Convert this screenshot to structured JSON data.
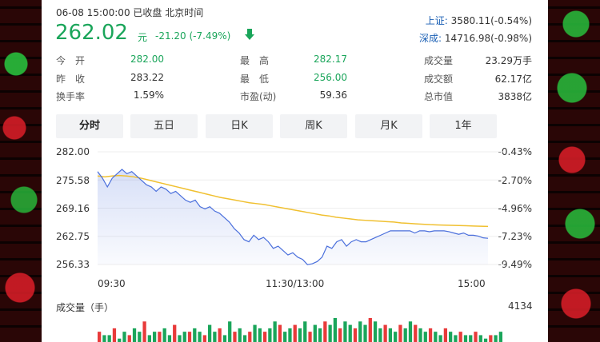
{
  "header": {
    "timestamp": "06-08 15:00:00  已收盘  北京时间",
    "price": "262.02",
    "unit": "元",
    "change": "-21.20 (-7.49%)"
  },
  "indices": [
    {
      "name": "上证:",
      "value": "3580.11(-0.54%)"
    },
    {
      "name": "深成:",
      "value": "14716.98(-0.98%)"
    }
  ],
  "stats": {
    "col1": [
      {
        "label": "今　开",
        "value": "282.00",
        "tone": "green"
      },
      {
        "label": "昨　收",
        "value": "283.22",
        "tone": "plain"
      },
      {
        "label": "换手率",
        "value": "1.59%",
        "tone": "plain"
      }
    ],
    "col2": [
      {
        "label": "最　高",
        "value": "282.17",
        "tone": "green"
      },
      {
        "label": "最　低",
        "value": "256.00",
        "tone": "green"
      },
      {
        "label": "市盈(动)",
        "value": "59.36",
        "tone": "plain"
      }
    ],
    "col3": [
      {
        "label": "成交量",
        "value": "23.29万手"
      },
      {
        "label": "成交额",
        "value": "62.17亿"
      },
      {
        "label": "总市值",
        "value": "3838亿"
      }
    ]
  },
  "tabs": [
    "分时",
    "五日",
    "日K",
    "周K",
    "月K",
    "1年"
  ],
  "volume": {
    "title": "成交量（手）",
    "max_label": "4134"
  },
  "colors": {
    "down": "#1aa55a",
    "up": "#e83a3a",
    "price_line": "#4a6fdc",
    "avg_line": "#f0c030"
  },
  "chart_data": {
    "type": "line",
    "x": [
      "09:30",
      "11:30/13:00",
      "15:00"
    ],
    "ylim": [
      256.33,
      282.0
    ],
    "y_ticks": [
      "282.00",
      "275.58",
      "269.16",
      "262.75",
      "256.33"
    ],
    "right_ticks": [
      "-0.43%",
      "-2.70%",
      "-4.96%",
      "-7.23%",
      "-9.49%"
    ],
    "series": [
      {
        "values": [
          277.5,
          276,
          274,
          276,
          277,
          278,
          277,
          277.5,
          276.5,
          275.5,
          274.5,
          274,
          273,
          274,
          273.5,
          272.5,
          273,
          272,
          271,
          270.5,
          271,
          269.5,
          269,
          269.5,
          268.5,
          268,
          267,
          266,
          264.5,
          263.5,
          262,
          261.5,
          263,
          262,
          262.5,
          261.5,
          260,
          260.5,
          259.5,
          258.5,
          259,
          258,
          257.5,
          256.3,
          256.5,
          257,
          258,
          260.5,
          260,
          261.5,
          262,
          260.5,
          261.5,
          262,
          261.5,
          261.5,
          262,
          262.5,
          263,
          263.5,
          264,
          264,
          264,
          264,
          264,
          263.5,
          264,
          264,
          263.8,
          264,
          264,
          264,
          263.8,
          263.5,
          263.2,
          263.5,
          263,
          263,
          262.8,
          262.4,
          262.3
        ]
      },
      {
        "values": [
          276.5,
          276.3,
          276.5,
          276.6,
          276.5,
          276.3,
          276,
          275.6,
          275.2,
          274.8,
          274.4,
          274,
          273.6,
          273.2,
          272.8,
          272.4,
          272,
          271.6,
          271.3,
          271,
          270.7,
          270.4,
          270.2,
          270,
          269.7,
          269.4,
          269.1,
          268.8,
          268.5,
          268.2,
          267.9,
          267.6,
          267.4,
          267.1,
          266.9,
          266.7,
          266.5,
          266.4,
          266.3,
          266.2,
          266.1,
          266.0,
          265.8,
          265.7,
          265.6,
          265.5,
          265.4,
          265.35,
          265.3,
          265.25,
          265.2,
          265.15,
          265.1,
          265.05,
          265.0
        ]
      }
    ],
    "volume_values": [
      3,
      2,
      2,
      4,
      1,
      3,
      2,
      4,
      3,
      6,
      2,
      3,
      3,
      4,
      2,
      5,
      2,
      3,
      3,
      4,
      3,
      2,
      5,
      3,
      4,
      2,
      6,
      3,
      4,
      2,
      3,
      5,
      4,
      3,
      4,
      6,
      5,
      3,
      4,
      5,
      4,
      6,
      3,
      5,
      4,
      6,
      5,
      7,
      4,
      6,
      5,
      4,
      6,
      5,
      7,
      6,
      4,
      5,
      4,
      3,
      5,
      4,
      6,
      5,
      4,
      3,
      4,
      3,
      2,
      4,
      3,
      2,
      3,
      2,
      2,
      3,
      2,
      1,
      2,
      2,
      3
    ]
  }
}
